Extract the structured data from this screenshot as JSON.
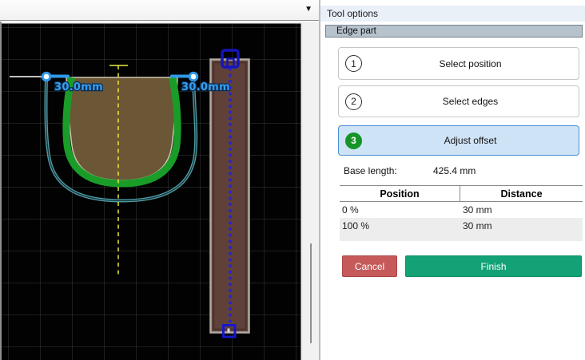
{
  "toolbar": {
    "dropdown_icon": "▼"
  },
  "canvas": {
    "dimension_left": "30.0mm",
    "dimension_right": "30.0mm"
  },
  "panel": {
    "title": "Tool options",
    "section_header": "Edge part",
    "steps": [
      {
        "number": "1",
        "label": "Select position",
        "active": false
      },
      {
        "number": "2",
        "label": "Select edges",
        "active": false
      },
      {
        "number": "3",
        "label": "Adjust offset",
        "active": true
      }
    ],
    "base_length": {
      "label": "Base length:",
      "value": "425.4 mm"
    },
    "table": {
      "headers": [
        "Position",
        "Distance"
      ],
      "rows": [
        {
          "position": "0 %",
          "distance": "30 mm"
        },
        {
          "position": "100 %",
          "distance": "30 mm"
        }
      ]
    },
    "actions": {
      "cancel": "Cancel",
      "finish": "Finish"
    }
  },
  "colors": {
    "edge_highlight_green": "#1a9c28",
    "offset_curve_teal": "#4f9ba4",
    "pocket_fill_tan": "#6b5636",
    "bar_fill_brown": "#5f413a",
    "dimension_blue": "#35a0f0",
    "anchor_blue": "#1717bd",
    "centerline_yellow": "#e9e93e",
    "active_step_bg": "#cfe3f6",
    "active_step_border": "#4a8fd3",
    "step_badge_green": "#169428",
    "cancel_button_red": "#c65a5a",
    "finish_button_green": "#12a276"
  }
}
